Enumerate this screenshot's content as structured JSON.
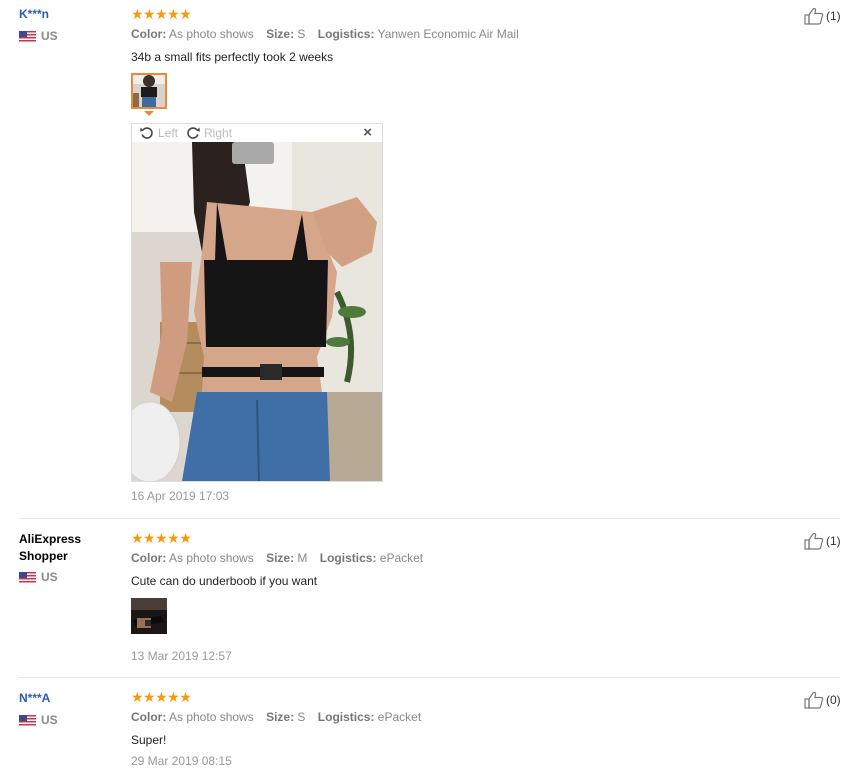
{
  "reviews": [
    {
      "user": "K***n",
      "country": "US",
      "rating": "★★★★★",
      "color_label": "Color:",
      "color": "As photo shows",
      "size_label": "Size:",
      "size": "S",
      "logistics_label": "Logistics:",
      "logistics": "Yanwen Economic Air Mail",
      "text": "34b a small fits perfectly took 2 weeks",
      "date": "16 Apr 2019 17:03",
      "likes": "(1)",
      "viewer": {
        "left_label": "Left",
        "right_label": "Right",
        "close": "×"
      }
    },
    {
      "user": "AliExpress Shopper",
      "country": "US",
      "rating": "★★★★★",
      "color_label": "Color:",
      "color": "As photo shows",
      "size_label": "Size:",
      "size": "M",
      "logistics_label": "Logistics:",
      "logistics": "ePacket",
      "text": "Cute can do underboob if you want",
      "date": "13 Mar 2019 12:57",
      "likes": "(1)"
    },
    {
      "user": "N***A",
      "country": "US",
      "rating": "★★★★★",
      "color_label": "Color:",
      "color": "As photo shows",
      "size_label": "Size:",
      "size": "S",
      "logistics_label": "Logistics:",
      "logistics": "ePacket",
      "text": "Super!",
      "date": "29 Mar 2019 08:15",
      "likes": "(0)"
    }
  ],
  "icons": {
    "flag": "us-flag-icon",
    "like": "thumbs-up-icon",
    "rotate_left": "rotate-left-icon",
    "rotate_right": "rotate-right-icon",
    "close": "close-icon"
  },
  "colors": {
    "star": "#f59a0f",
    "username_link": "#2b5bb5",
    "thumb_active_border": "#e78a3c"
  }
}
